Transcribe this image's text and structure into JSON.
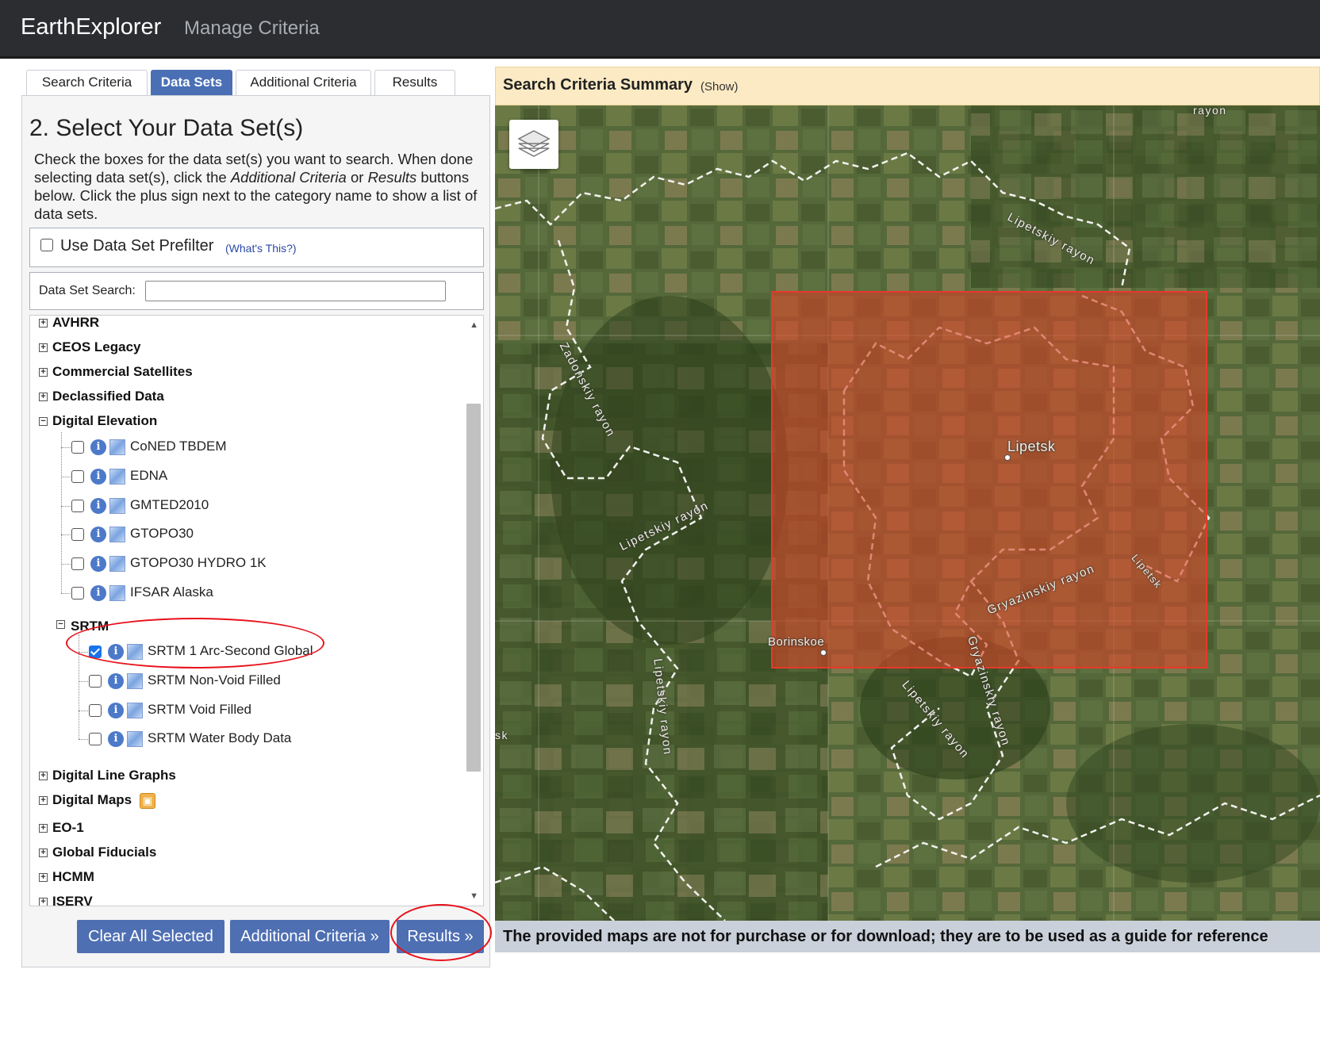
{
  "header": {
    "brand": "EarthExplorer",
    "manage_link": "Manage Criteria"
  },
  "tabs": [
    {
      "label": "Search Criteria",
      "active": false
    },
    {
      "label": "Data Sets",
      "active": true
    },
    {
      "label": "Additional Criteria",
      "active": false
    },
    {
      "label": "Results",
      "active": false
    }
  ],
  "panel": {
    "title": "2. Select Your Data Set(s)",
    "desc_part1": "Check the boxes for the data set(s) you want to search. When done selecting data set(s), click the ",
    "desc_em1": "Additional Criteria",
    "desc_part2": " or ",
    "desc_em2": "Results",
    "desc_part3": " buttons below. Click the plus sign next to the category name to show a list of data sets.",
    "prefilter_label": "Use Data Set Prefilter",
    "prefilter_help": "(What's This?)",
    "search_label": "Data Set Search:",
    "search_value": ""
  },
  "tree": {
    "categories_top": [
      "AVHRR",
      "CEOS Legacy",
      "Commercial Satellites",
      "Declassified Data",
      "Digital Elevation"
    ],
    "digital_elevation_items": [
      {
        "label": "CoNED TBDEM",
        "checked": false
      },
      {
        "label": "EDNA",
        "checked": false
      },
      {
        "label": "GMTED2010",
        "checked": false
      },
      {
        "label": "GTOPO30",
        "checked": false
      },
      {
        "label": "GTOPO30 HYDRO 1K",
        "checked": false
      },
      {
        "label": "IFSAR Alaska",
        "checked": false
      }
    ],
    "srtm_label": "SRTM",
    "srtm_items": [
      {
        "label": "SRTM 1 Arc-Second Global",
        "checked": true
      },
      {
        "label": "SRTM Non-Void Filled",
        "checked": false
      },
      {
        "label": "SRTM Void Filled",
        "checked": false
      },
      {
        "label": "SRTM Water Body Data",
        "checked": false
      }
    ],
    "categories_bottom": [
      "Digital Line Graphs",
      "Digital Maps",
      "EO-1",
      "Global Fiducials",
      "HCMM",
      "ISERV"
    ],
    "collapsed_symbol": "+",
    "expanded_symbol": "−",
    "info_glyph": "i"
  },
  "buttons": {
    "clear": "Clear All Selected",
    "additional": "Additional Criteria »",
    "results": "Results »"
  },
  "map": {
    "summary_title": "Search Criteria Summary",
    "summary_show": "(Show)",
    "labels": {
      "top_rayon": "rayon",
      "lipetskiy_ne": "Lipetskiy rayon",
      "zadonskiy": "Zadonskiy rayon",
      "lipetskiy_w": "Lipetskiy rayon",
      "lipetsk": "Lipetsk",
      "gryazinskiy": "Gryazinskiy rayon",
      "lipetsk_e": "Lipetsk",
      "borinskoe": "Borinskoe",
      "gryazinskiy_s": "Gryazinskiy rayon",
      "lipetskiy_s": "Lipetskiy rayon",
      "lipetskiy_loop": "Lipetskiy rayon",
      "sk": "sk"
    },
    "disclaimer": "The provided maps are not for purchase or for download; they are to be used as a guide for reference"
  },
  "colors": {
    "header_bg": "#2b2d30",
    "tab_active": "#4a6fb5",
    "button": "#4f6fb3",
    "summary_bg": "#fbeac4",
    "selection_fill": "#d44628",
    "annotation": "#e8111b"
  }
}
